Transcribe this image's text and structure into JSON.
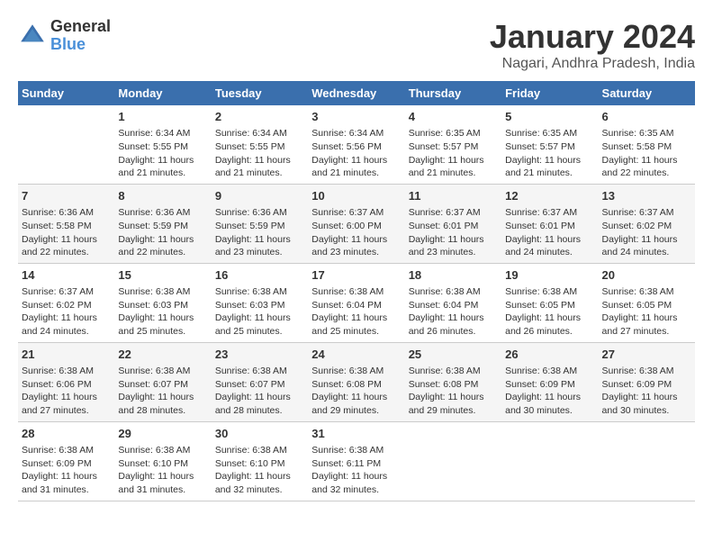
{
  "logo": {
    "line1": "General",
    "line2": "Blue"
  },
  "title": "January 2024",
  "subtitle": "Nagari, Andhra Pradesh, India",
  "days_header": [
    "Sunday",
    "Monday",
    "Tuesday",
    "Wednesday",
    "Thursday",
    "Friday",
    "Saturday"
  ],
  "weeks": [
    [
      {
        "num": "",
        "info": ""
      },
      {
        "num": "1",
        "info": "Sunrise: 6:34 AM\nSunset: 5:55 PM\nDaylight: 11 hours and 21 minutes."
      },
      {
        "num": "2",
        "info": "Sunrise: 6:34 AM\nSunset: 5:55 PM\nDaylight: 11 hours and 21 minutes."
      },
      {
        "num": "3",
        "info": "Sunrise: 6:34 AM\nSunset: 5:56 PM\nDaylight: 11 hours and 21 minutes."
      },
      {
        "num": "4",
        "info": "Sunrise: 6:35 AM\nSunset: 5:57 PM\nDaylight: 11 hours and 21 minutes."
      },
      {
        "num": "5",
        "info": "Sunrise: 6:35 AM\nSunset: 5:57 PM\nDaylight: 11 hours and 21 minutes."
      },
      {
        "num": "6",
        "info": "Sunrise: 6:35 AM\nSunset: 5:58 PM\nDaylight: 11 hours and 22 minutes."
      }
    ],
    [
      {
        "num": "7",
        "info": "Sunrise: 6:36 AM\nSunset: 5:58 PM\nDaylight: 11 hours and 22 minutes."
      },
      {
        "num": "8",
        "info": "Sunrise: 6:36 AM\nSunset: 5:59 PM\nDaylight: 11 hours and 22 minutes."
      },
      {
        "num": "9",
        "info": "Sunrise: 6:36 AM\nSunset: 5:59 PM\nDaylight: 11 hours and 23 minutes."
      },
      {
        "num": "10",
        "info": "Sunrise: 6:37 AM\nSunset: 6:00 PM\nDaylight: 11 hours and 23 minutes."
      },
      {
        "num": "11",
        "info": "Sunrise: 6:37 AM\nSunset: 6:01 PM\nDaylight: 11 hours and 23 minutes."
      },
      {
        "num": "12",
        "info": "Sunrise: 6:37 AM\nSunset: 6:01 PM\nDaylight: 11 hours and 24 minutes."
      },
      {
        "num": "13",
        "info": "Sunrise: 6:37 AM\nSunset: 6:02 PM\nDaylight: 11 hours and 24 minutes."
      }
    ],
    [
      {
        "num": "14",
        "info": "Sunrise: 6:37 AM\nSunset: 6:02 PM\nDaylight: 11 hours and 24 minutes."
      },
      {
        "num": "15",
        "info": "Sunrise: 6:38 AM\nSunset: 6:03 PM\nDaylight: 11 hours and 25 minutes."
      },
      {
        "num": "16",
        "info": "Sunrise: 6:38 AM\nSunset: 6:03 PM\nDaylight: 11 hours and 25 minutes."
      },
      {
        "num": "17",
        "info": "Sunrise: 6:38 AM\nSunset: 6:04 PM\nDaylight: 11 hours and 25 minutes."
      },
      {
        "num": "18",
        "info": "Sunrise: 6:38 AM\nSunset: 6:04 PM\nDaylight: 11 hours and 26 minutes."
      },
      {
        "num": "19",
        "info": "Sunrise: 6:38 AM\nSunset: 6:05 PM\nDaylight: 11 hours and 26 minutes."
      },
      {
        "num": "20",
        "info": "Sunrise: 6:38 AM\nSunset: 6:05 PM\nDaylight: 11 hours and 27 minutes."
      }
    ],
    [
      {
        "num": "21",
        "info": "Sunrise: 6:38 AM\nSunset: 6:06 PM\nDaylight: 11 hours and 27 minutes."
      },
      {
        "num": "22",
        "info": "Sunrise: 6:38 AM\nSunset: 6:07 PM\nDaylight: 11 hours and 28 minutes."
      },
      {
        "num": "23",
        "info": "Sunrise: 6:38 AM\nSunset: 6:07 PM\nDaylight: 11 hours and 28 minutes."
      },
      {
        "num": "24",
        "info": "Sunrise: 6:38 AM\nSunset: 6:08 PM\nDaylight: 11 hours and 29 minutes."
      },
      {
        "num": "25",
        "info": "Sunrise: 6:38 AM\nSunset: 6:08 PM\nDaylight: 11 hours and 29 minutes."
      },
      {
        "num": "26",
        "info": "Sunrise: 6:38 AM\nSunset: 6:09 PM\nDaylight: 11 hours and 30 minutes."
      },
      {
        "num": "27",
        "info": "Sunrise: 6:38 AM\nSunset: 6:09 PM\nDaylight: 11 hours and 30 minutes."
      }
    ],
    [
      {
        "num": "28",
        "info": "Sunrise: 6:38 AM\nSunset: 6:09 PM\nDaylight: 11 hours and 31 minutes."
      },
      {
        "num": "29",
        "info": "Sunrise: 6:38 AM\nSunset: 6:10 PM\nDaylight: 11 hours and 31 minutes."
      },
      {
        "num": "30",
        "info": "Sunrise: 6:38 AM\nSunset: 6:10 PM\nDaylight: 11 hours and 32 minutes."
      },
      {
        "num": "31",
        "info": "Sunrise: 6:38 AM\nSunset: 6:11 PM\nDaylight: 11 hours and 32 minutes."
      },
      {
        "num": "",
        "info": ""
      },
      {
        "num": "",
        "info": ""
      },
      {
        "num": "",
        "info": ""
      }
    ]
  ]
}
